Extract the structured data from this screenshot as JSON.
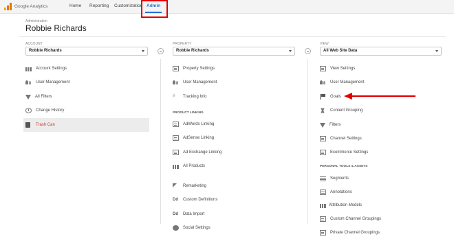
{
  "app": {
    "name": "Google Analytics"
  },
  "nav": {
    "items": [
      {
        "label": "Home"
      },
      {
        "label": "Reporting"
      },
      {
        "label": "Customization"
      },
      {
        "label": "Admin"
      }
    ]
  },
  "header": {
    "breadcrumb": "Administration",
    "title": "Robbie Richards"
  },
  "account": {
    "label": "ACCOUNT",
    "selected": "Robbie Richards",
    "items": [
      {
        "label": "Account Settings",
        "icon": "building-icon"
      },
      {
        "label": "User Management",
        "icon": "users-icon"
      },
      {
        "label": "All Filters",
        "icon": "filter-icon"
      },
      {
        "label": "Change History",
        "icon": "history-icon"
      },
      {
        "label": "Trash Can",
        "icon": "trash-icon"
      }
    ]
  },
  "property": {
    "label": "PROPERTY",
    "selected": "Robbie Richards",
    "items": [
      {
        "label": "Property Settings",
        "icon": "settings-box-icon"
      },
      {
        "label": "User Management",
        "icon": "users-icon"
      },
      {
        "label": "Tracking Info",
        "icon": "js-icon"
      }
    ],
    "linking_heading": "PRODUCT LINKING",
    "linking": [
      {
        "label": "AdWords Linking",
        "icon": "adwords-icon"
      },
      {
        "label": "AdSense Linking",
        "icon": "adsense-icon"
      },
      {
        "label": "Ad Exchange Linking",
        "icon": "adexchange-icon"
      },
      {
        "label": "All Products",
        "icon": "products-icon"
      }
    ],
    "more": [
      {
        "label": "Remarketing",
        "icon": "remarketing-icon"
      },
      {
        "label": "Custom Definitions",
        "icon": "dd-icon"
      },
      {
        "label": "Data Import",
        "icon": "dd-icon"
      },
      {
        "label": "Social Settings",
        "icon": "globe-icon"
      }
    ]
  },
  "view": {
    "label": "VIEW",
    "selected": "All Web Site Data",
    "items": [
      {
        "label": "View Settings",
        "icon": "settings-box-icon"
      },
      {
        "label": "User Management",
        "icon": "users-icon"
      },
      {
        "label": "Goals",
        "icon": "flag-icon"
      },
      {
        "label": "Content Grouping",
        "icon": "grouping-icon"
      },
      {
        "label": "Filters",
        "icon": "filter-icon"
      },
      {
        "label": "Channel Settings",
        "icon": "channel-icon"
      },
      {
        "label": "Ecommerce Settings",
        "icon": "cart-icon"
      }
    ],
    "tools_heading": "PERSONAL TOOLS & ASSETS",
    "tools": [
      {
        "label": "Segments",
        "icon": "segments-icon"
      },
      {
        "label": "Annotations",
        "icon": "annotations-icon"
      },
      {
        "label": "Attribution Models",
        "icon": "bars-icon"
      },
      {
        "label": "Custom Channel Groupings",
        "icon": "channel-icon"
      },
      {
        "label": "Private Channel Groupings",
        "icon": "channel-icon"
      }
    ]
  },
  "colors": {
    "accent": "#2a6ed0",
    "highlight": "#e00000",
    "active_text": "#d93025"
  }
}
